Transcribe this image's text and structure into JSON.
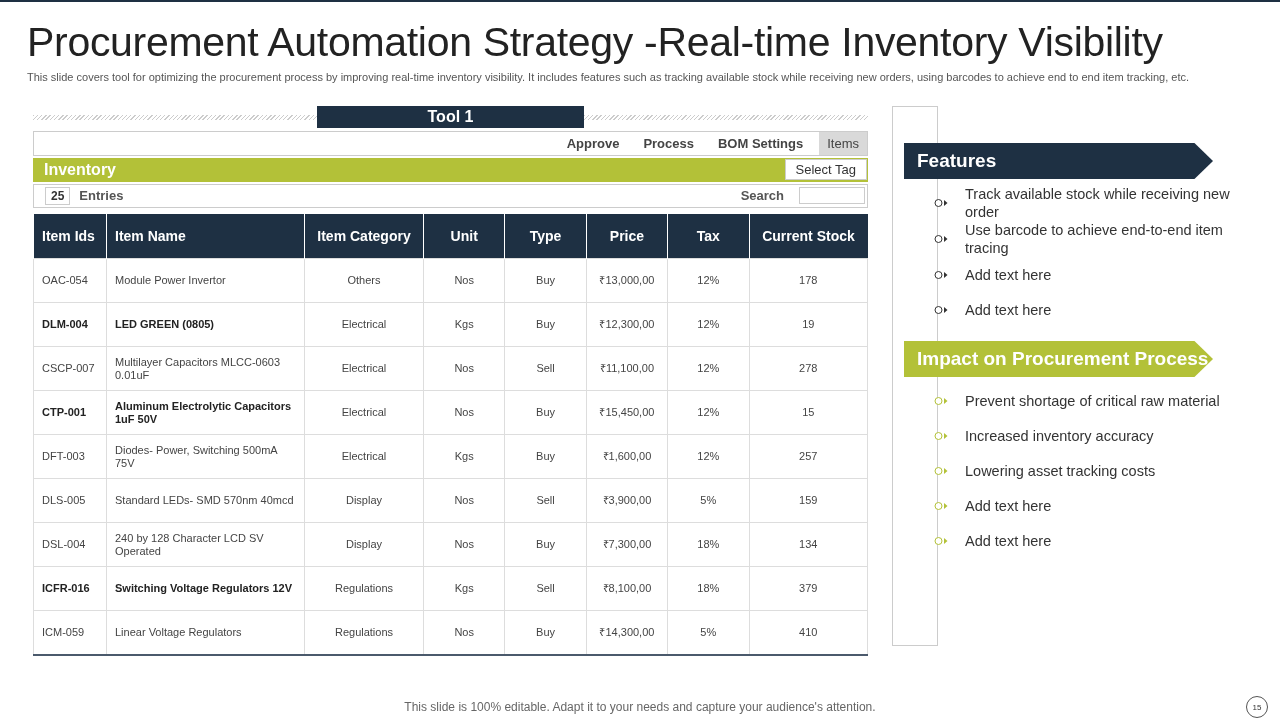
{
  "title": "Procurement Automation Strategy -Real-time Inventory Visibility",
  "description": "This slide covers tool for optimizing the procurement process by improving real-time inventory visibility. It includes features such as tracking available stock while receiving new orders, using barcodes to achieve end to  end item tracking, etc.",
  "tool": {
    "title": "Tool 1",
    "tabs": [
      {
        "label": "Approve",
        "selected": false
      },
      {
        "label": "Process",
        "selected": false
      },
      {
        "label": "BOM  Settings",
        "selected": false
      },
      {
        "label": "Items",
        "selected": true
      }
    ],
    "section_title": "Inventory",
    "select_tag": "Select Tag",
    "entries_value": "25",
    "entries_label": "Entries",
    "search_label": "Search",
    "table": {
      "columns": [
        "Item Ids",
        "Item Name",
        "Item Category",
        "Unit",
        "Type",
        "Price",
        "Tax",
        "Current Stock"
      ],
      "rows": [
        {
          "emphasized": false,
          "cells": [
            "OAC-054",
            "Module  Power Invertor",
            "Others",
            "Nos",
            "Buy",
            "₹13,000,00",
            "12%",
            "178"
          ]
        },
        {
          "emphasized": true,
          "cells": [
            "DLM-004",
            "LED GREEN   (0805)",
            "Electrical",
            "Kgs",
            "Buy",
            "₹12,300,00",
            "12%",
            "19"
          ]
        },
        {
          "emphasized": false,
          "cells": [
            "CSCP-007",
            "Multilayer  Capacitors MLCC-0603 0.01uF",
            "Electrical",
            "Nos",
            "Sell",
            "₹11,100,00",
            "12%",
            "278"
          ]
        },
        {
          "emphasized": true,
          "cells": [
            "CTP-001",
            "Aluminum Electrolytic Capacitors 1uF 50V",
            "Electrical",
            "Nos",
            "Buy",
            "₹15,450,00",
            "12%",
            "15"
          ]
        },
        {
          "emphasized": false,
          "cells": [
            "DFT-003",
            "Diodes- Power, Switching 500mA 75V",
            "Electrical",
            "Kgs",
            "Buy",
            "₹1,600,00",
            "12%",
            "257"
          ]
        },
        {
          "emphasized": false,
          "cells": [
            "DLS-005",
            "Standard LEDs- SMD  570nm  40mcd",
            "Display",
            "Nos",
            "Sell",
            "₹3,900,00",
            "5%",
            "159"
          ]
        },
        {
          "emphasized": false,
          "cells": [
            "DSL-004",
            "240 by 128 Character LCD  SV Operated",
            "Display",
            "Nos",
            "Buy",
            "₹7,300,00",
            "18%",
            "134"
          ]
        },
        {
          "emphasized": true,
          "cells": [
            "ICFR-016",
            "Switching Voltage Regulators 12V",
            "Regulations",
            "Kgs",
            "Sell",
            "₹8,100,00",
            "18%",
            "379"
          ]
        },
        {
          "emphasized": false,
          "cells": [
            "ICM-059",
            "Linear Voltage Regulators",
            "Regulations",
            "Nos",
            "Buy",
            "₹14,300,00",
            "5%",
            "410"
          ]
        }
      ]
    }
  },
  "sections": [
    {
      "kind": "dark",
      "title": "Features",
      "items": [
        "Track available  stock while receiving new order",
        "Use barcode to achieve end-to-end item tracing",
        "Add text here",
        "Add text here"
      ]
    },
    {
      "kind": "green",
      "title": "Impact on Procurement Process",
      "items": [
        "Prevent shortage of critical raw material",
        "Increased inventory  accuracy",
        "Lowering asset tracking costs",
        "Add text here",
        "Add text here"
      ]
    }
  ],
  "footer": "This slide is 100% editable. Adapt it to your needs and capture your audience's attention.",
  "page_number": "15"
}
